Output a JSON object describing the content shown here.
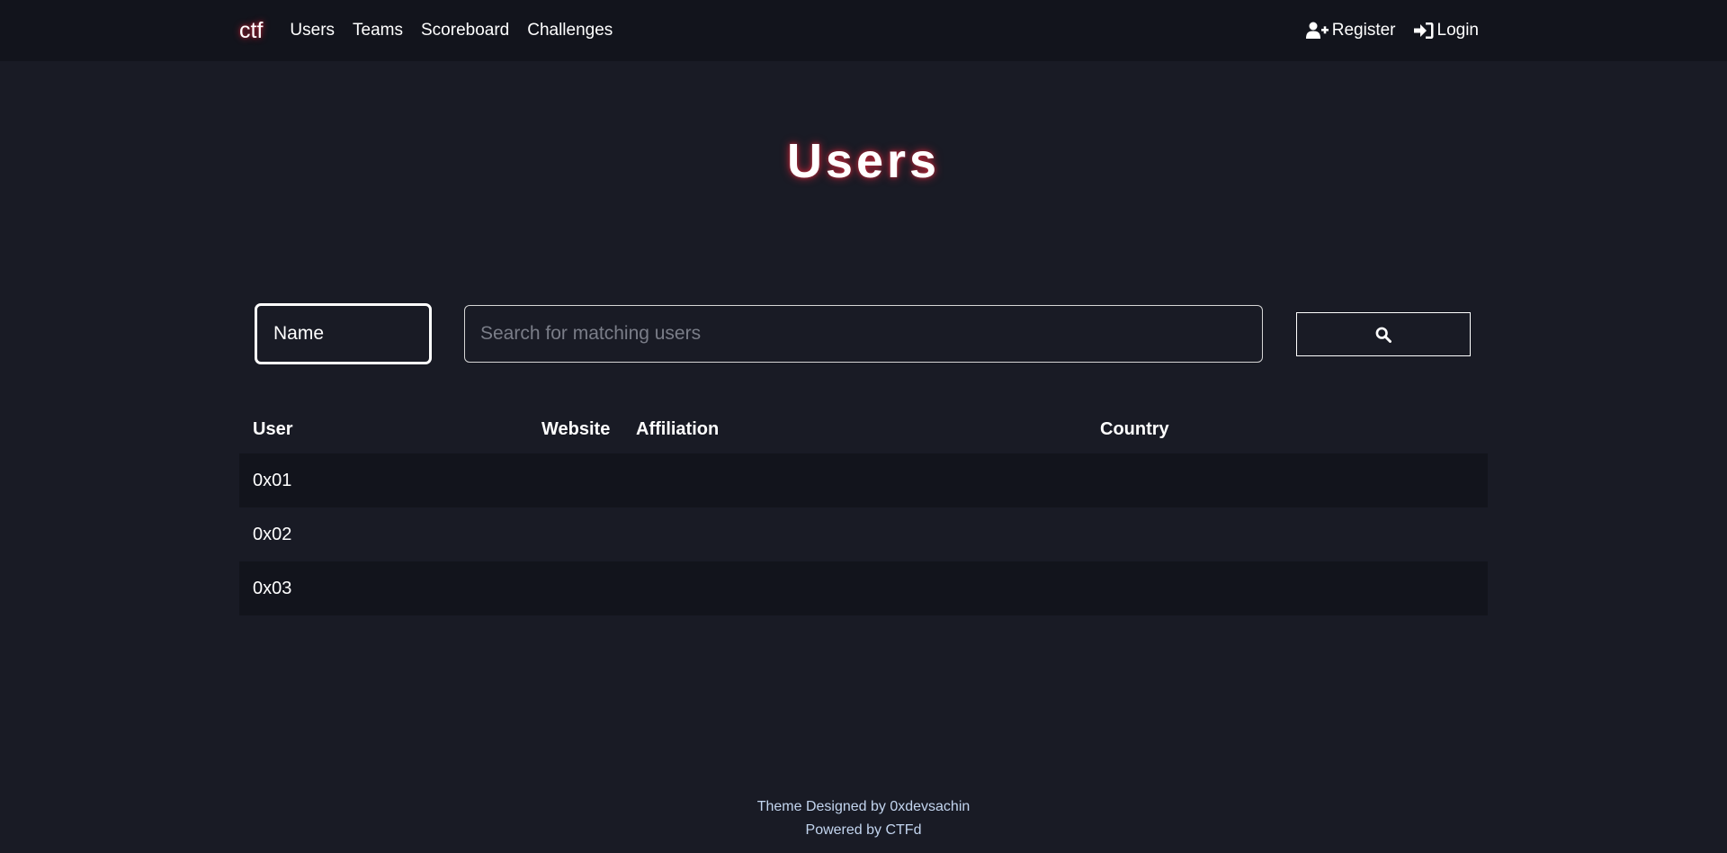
{
  "navbar": {
    "brand": "ctf",
    "links": [
      "Users",
      "Teams",
      "Scoreboard",
      "Challenges"
    ],
    "register": "Register",
    "login": "Login"
  },
  "page": {
    "title": "Users"
  },
  "search": {
    "field_value": "Name",
    "placeholder": "Search for matching users",
    "button_icon": "search-icon"
  },
  "table": {
    "headers": [
      "User",
      "Website",
      "Affiliation",
      "Country"
    ],
    "rows": [
      {
        "user": "0x01",
        "website": "",
        "affiliation": "",
        "country": ""
      },
      {
        "user": "0x02",
        "website": "",
        "affiliation": "",
        "country": ""
      },
      {
        "user": "0x03",
        "website": "",
        "affiliation": "",
        "country": ""
      }
    ]
  },
  "footer": {
    "theme": "Theme Designed by 0xdevsachin",
    "powered": "Powered by CTFd"
  },
  "colors": {
    "background": "#191b25",
    "navbar": "#12141c",
    "glow": "#dc283c",
    "footer_text": "#c3d5ef"
  }
}
